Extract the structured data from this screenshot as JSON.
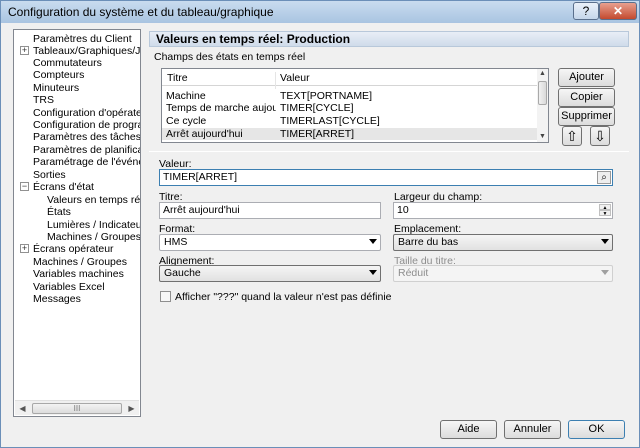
{
  "window": {
    "title": "Configuration du système et du tableau/graphique",
    "help_label": "?",
    "close_label": "✕"
  },
  "tree": {
    "items": [
      "Paramètres du Client",
      "Tableaux/Graphiques/Journal",
      "Commutateurs",
      "Compteurs",
      "Minuteurs",
      "TRS",
      "Configuration d'opérateur",
      "Configuration de programme",
      "Paramètres des tâches",
      "Paramètres de planification",
      "Paramétrage de l'événement",
      "Sorties",
      "Écrans d'état",
      "Valeurs en temps réel",
      "États",
      "Lumières / Indicateurs",
      "Machines / Groupes",
      "Écrans opérateur",
      "Machines / Groupes",
      "Variables machines",
      "Variables Excel",
      "Messages"
    ],
    "expand_plus": "+",
    "expand_minus": "−",
    "scroll_left": "◀",
    "scroll_right": "▶",
    "scroll_grip": "III"
  },
  "panel": {
    "header": "Valeurs en temps réel: Production",
    "section_title": "Champs des états en temps réel"
  },
  "list": {
    "columns": [
      "Titre",
      "Valeur"
    ],
    "rows": [
      {
        "titre": "Machine",
        "valeur": "TEXT[PORTNAME]"
      },
      {
        "titre": "Temps de marche aujourd'hui",
        "valeur": "TIMER[CYCLE]"
      },
      {
        "titre": "Ce cycle",
        "valeur": "TIMERLAST[CYCLE]"
      },
      {
        "titre": "Arrêt aujourd'hui",
        "valeur": "TIMER[ARRET]"
      }
    ],
    "scroll_up": "▲",
    "scroll_down": "▼"
  },
  "buttons": {
    "add": "Ajouter",
    "copy": "Copier",
    "delete": "Supprimer",
    "move_up": "⇧",
    "move_down": "⇩",
    "help": "Aide",
    "cancel": "Annuler",
    "ok": "OK"
  },
  "form": {
    "value_label": "Valeur:",
    "value": "TIMER[ARRET]",
    "search_icon": "⌕",
    "title_label": "Titre:",
    "title_value": "Arrêt aujourd'hui",
    "width_label": "Largeur du champ:",
    "width_value": "10",
    "spin_up": "▲",
    "spin_down": "▼",
    "format_label": "Format:",
    "format_value": "HMS",
    "location_label": "Emplacement:",
    "location_value": "Barre du bas",
    "alignment_label": "Alignement:",
    "alignment_value": "Gauche",
    "title_size_label": "Taille du titre:",
    "title_size_value": "Réduit",
    "checkbox_label": "Afficher \"???\" quand la valeur n'est pas définie"
  }
}
